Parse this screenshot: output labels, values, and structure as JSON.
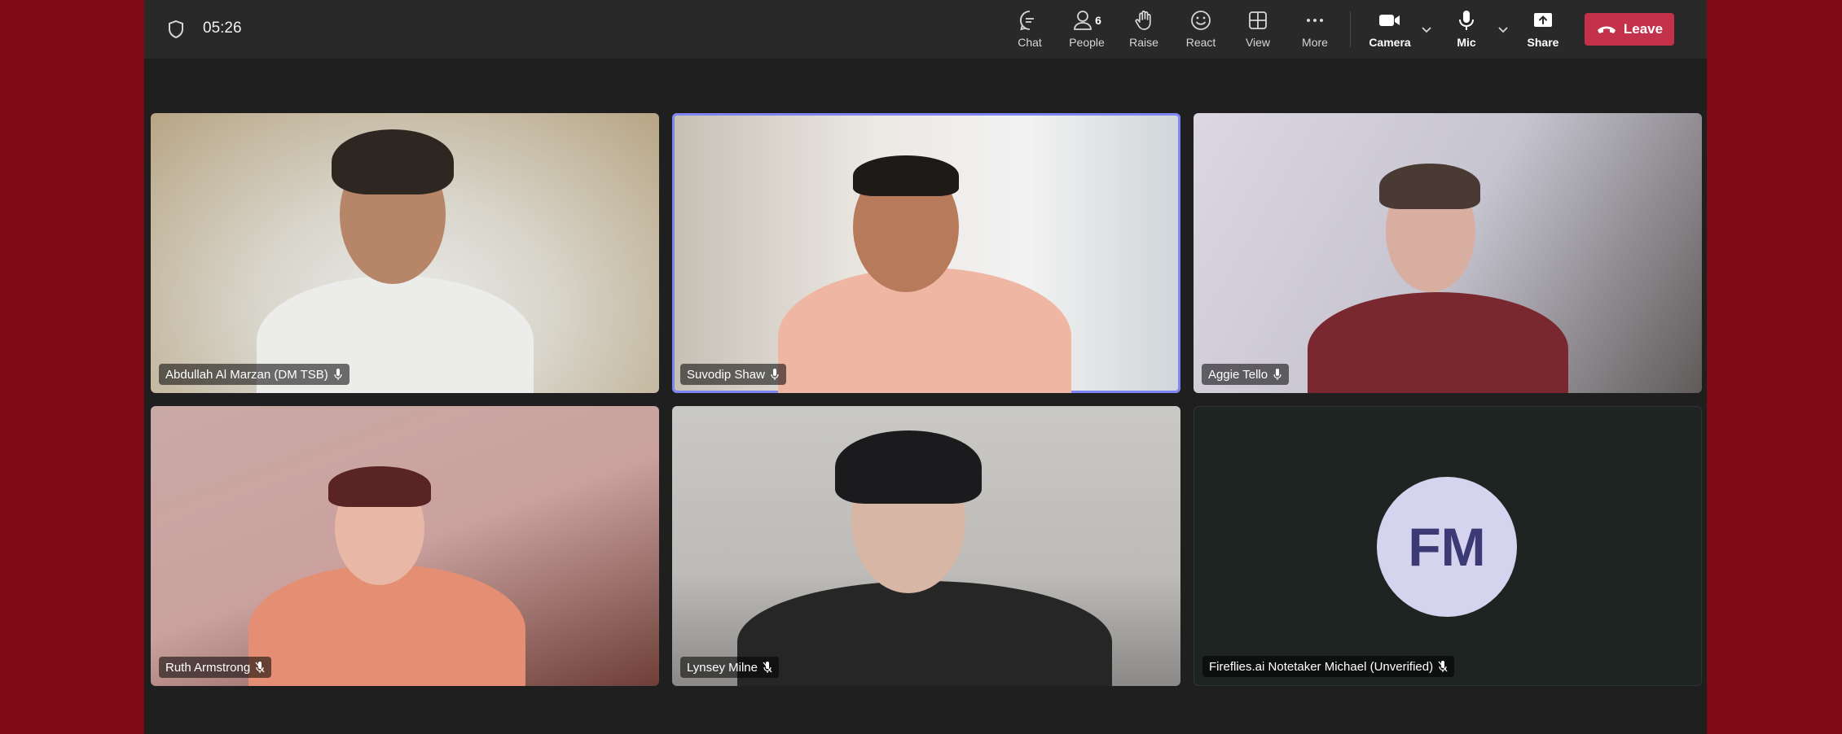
{
  "meeting": {
    "timer": "05:26"
  },
  "toolbar": {
    "chat": "Chat",
    "people": "People",
    "people_count": "6",
    "raise": "Raise",
    "react": "React",
    "view": "View",
    "more": "More",
    "camera": "Camera",
    "mic": "Mic",
    "share": "Share",
    "leave": "Leave"
  },
  "participants": [
    {
      "name": "Abdullah Al Marzan (DM TSB)",
      "mic": "on"
    },
    {
      "name": "Suvodip Shaw",
      "mic": "on",
      "speaking": true
    },
    {
      "name": "Aggie Tello",
      "mic": "on"
    },
    {
      "name": "Ruth Armstrong",
      "mic": "muted"
    },
    {
      "name": "Lynsey Milne",
      "mic": "muted"
    },
    {
      "name": "Fireflies.ai Notetaker Michael (Unverified)",
      "mic": "muted",
      "initials": "FM"
    }
  ],
  "colors": {
    "desktop": "#7f0a16",
    "leave_button": "#c4314b",
    "active_speaker_outline": "#7f85f5",
    "avatar_bg": "#d5d3ee"
  }
}
